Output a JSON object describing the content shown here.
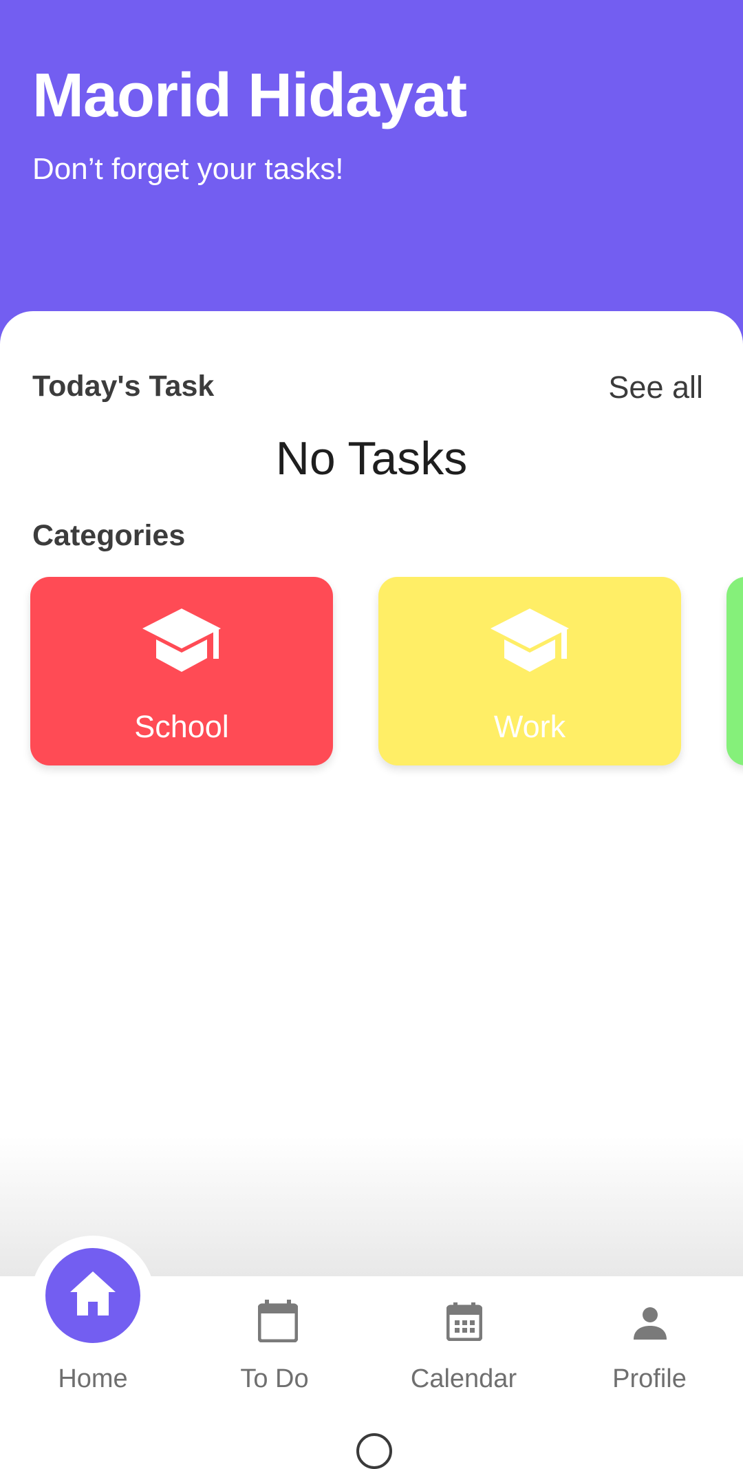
{
  "header": {
    "name": "Maorid Hidayat",
    "subtitle": "Don’t forget your tasks!",
    "color": "#735EF1"
  },
  "today": {
    "title": "Today's Task",
    "see_all": "See all",
    "empty": "No Tasks"
  },
  "categories": {
    "title": "Categories",
    "items": [
      {
        "label": "School",
        "color": "#FF4B55",
        "icon": "graduation-cap-icon"
      },
      {
        "label": "Work",
        "color": "#FFEE66",
        "icon": "graduation-cap-icon"
      },
      {
        "label": "",
        "color": "#85F07A",
        "icon": "graduation-cap-icon"
      }
    ]
  },
  "nav": {
    "items": [
      {
        "label": "Home",
        "icon": "home-icon",
        "active": true
      },
      {
        "label": "To Do",
        "icon": "calendar-blank-icon",
        "active": false
      },
      {
        "label": "Calendar",
        "icon": "calendar-icon",
        "active": false
      },
      {
        "label": "Profile",
        "icon": "person-icon",
        "active": false
      }
    ]
  }
}
